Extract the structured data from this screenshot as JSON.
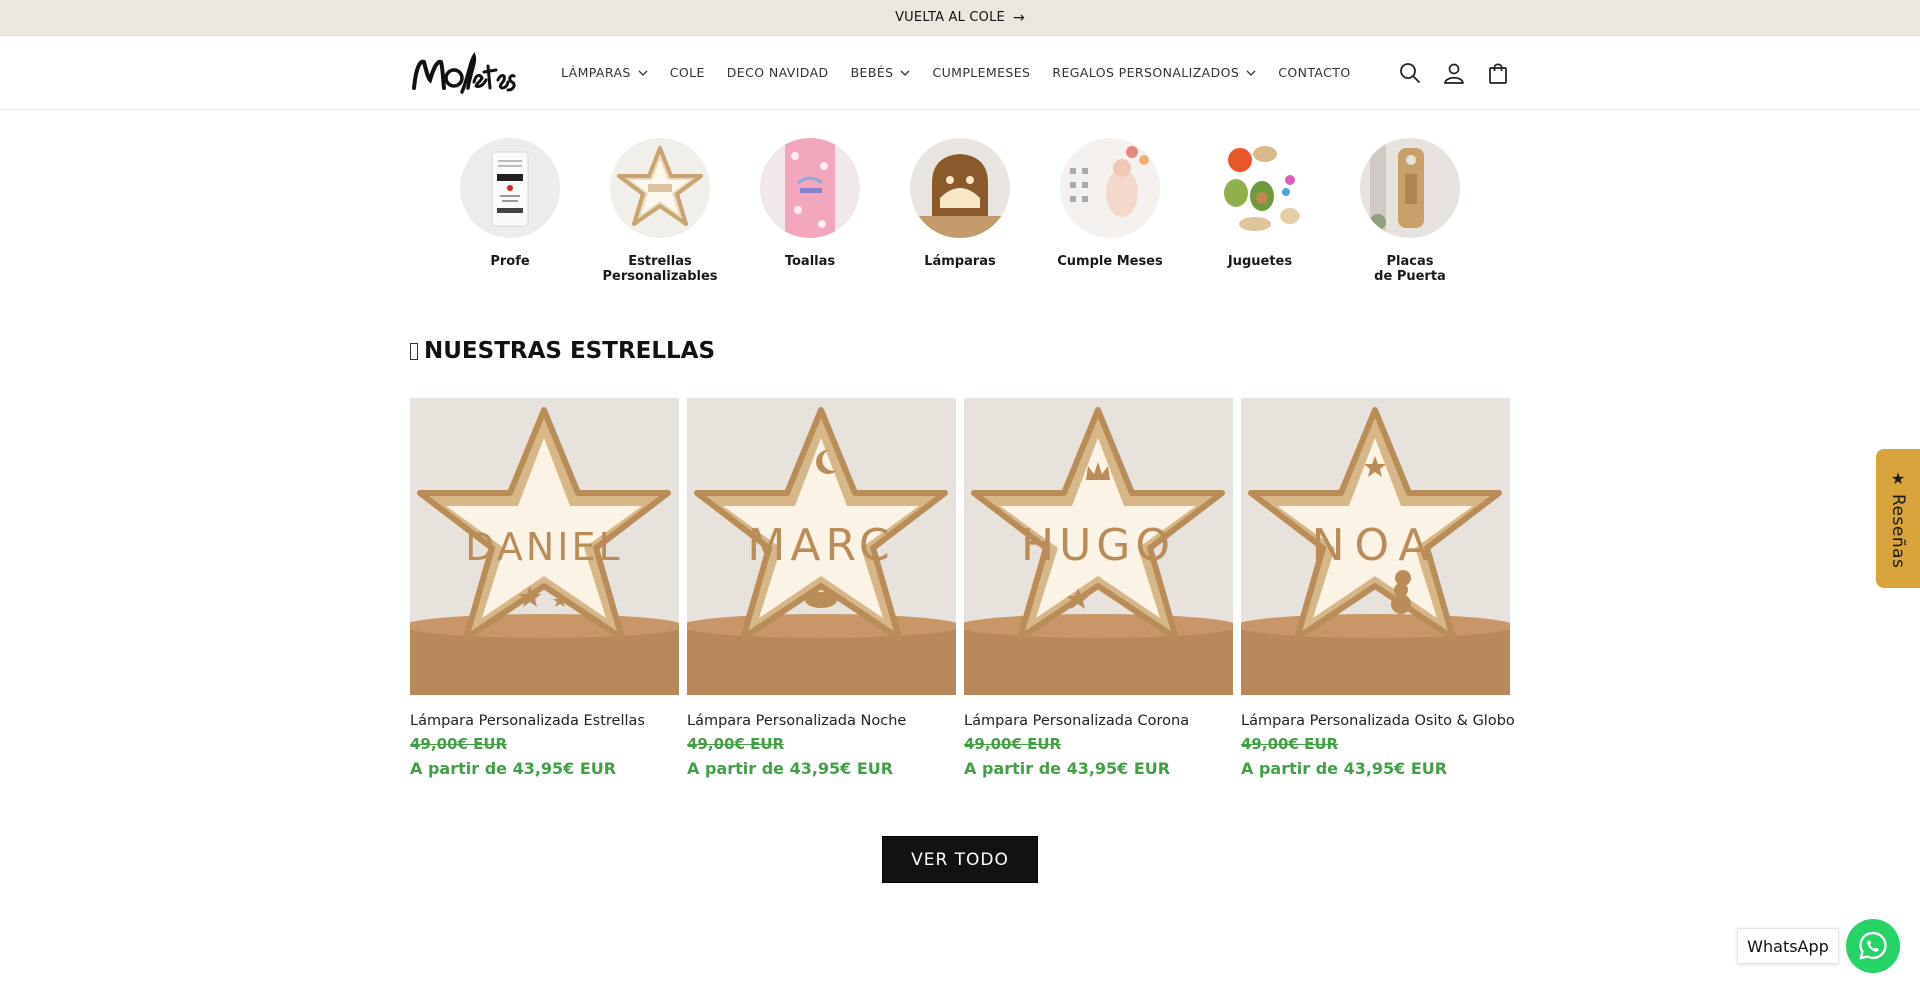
{
  "announcement": {
    "text": "VUELTA AL COLE"
  },
  "header": {
    "logo_text": "Mofletes",
    "nav": [
      {
        "label": "LÁMPARAS",
        "dropdown": true
      },
      {
        "label": "COLE",
        "dropdown": false
      },
      {
        "label": "DECO NAVIDAD",
        "dropdown": false
      },
      {
        "label": "BEBÉS",
        "dropdown": true
      },
      {
        "label": "CUMPLEMESES",
        "dropdown": false
      },
      {
        "label": "REGALOS PERSONALIZADOS",
        "dropdown": true
      },
      {
        "label": "CONTACTO",
        "dropdown": false
      }
    ],
    "icons": [
      "search-icon",
      "account-icon",
      "cart-icon"
    ]
  },
  "categories": [
    {
      "label": "Profe"
    },
    {
      "label": "Estrellas\nPersonalizables"
    },
    {
      "label": "Toallas"
    },
    {
      "label": "Lámparas"
    },
    {
      "label": "Cumple Meses"
    },
    {
      "label": "Juguetes"
    },
    {
      "label": "Placas\nde Puerta"
    }
  ],
  "featured": {
    "title": "NUESTRAS ESTRELLAS",
    "products": [
      {
        "name": "Lámpara Personalizada Estrellas",
        "lamp_text": "DANIEL",
        "old_price": "49,00€ EUR",
        "price": "A partir de 43,95€ EUR"
      },
      {
        "name": "Lámpara Personalizada Noche",
        "lamp_text": "MARC",
        "old_price": "49,00€ EUR",
        "price": "A partir de 43,95€ EUR"
      },
      {
        "name": "Lámpara Personalizada Corona",
        "lamp_text": "HUGO",
        "old_price": "49,00€ EUR",
        "price": "A partir de 43,95€ EUR"
      },
      {
        "name": "Lámpara Personalizada Osito & Globo",
        "lamp_text": "NOA",
        "old_price": "49,00€ EUR",
        "price": "A partir de 43,95€ EUR"
      }
    ],
    "view_all": "VER TODO"
  },
  "reviews_tab": {
    "label": "Reseñas"
  },
  "whatsapp": {
    "label": "WhatsApp"
  },
  "colors": {
    "announcement_bg": "#ebe7de",
    "price_green": "#43a047",
    "reviews_tab": "#d9a43b",
    "whatsapp": "#25d366"
  }
}
